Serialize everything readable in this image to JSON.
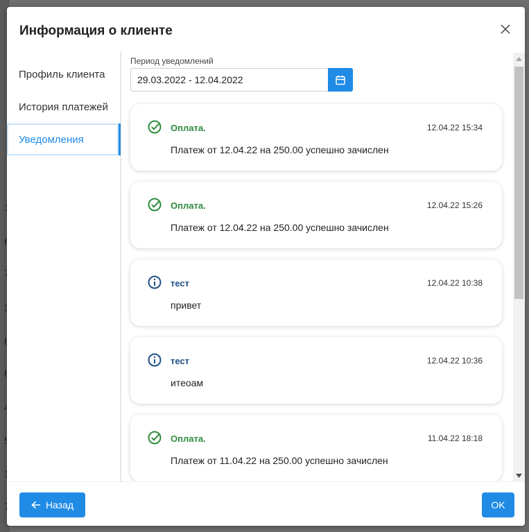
{
  "background": {
    "fragments": [
      "1",
      "6",
      "7",
      "3",
      "6",
      "6",
      "4",
      "5",
      "1",
      "7"
    ]
  },
  "dialog": {
    "title": "Информация о клиенте",
    "close_icon": "close-icon"
  },
  "sidebar": {
    "items": [
      {
        "label": "Профиль клиента",
        "active": false
      },
      {
        "label": "История платежей",
        "active": false
      },
      {
        "label": "Уведомления",
        "active": true
      }
    ]
  },
  "filter": {
    "period_label": "Период уведомлений",
    "date_range": "29.03.2022 - 12.04.2022",
    "calendar_icon": "calendar-icon"
  },
  "notifications": [
    {
      "type": "success",
      "icon": "check-circle-icon",
      "title": "Оплата.",
      "time": "12.04.22 15:34",
      "message": "Платеж от 12.04.22 на 250.00 успешно зачислен"
    },
    {
      "type": "success",
      "icon": "check-circle-icon",
      "title": "Оплата.",
      "time": "12.04.22 15:26",
      "message": "Платеж от 12.04.22 на 250.00 успешно зачислен"
    },
    {
      "type": "info",
      "icon": "info-circle-icon",
      "title": "тест",
      "time": "12.04.22 10:38",
      "message": "привет"
    },
    {
      "type": "info",
      "icon": "info-circle-icon",
      "title": "тест",
      "time": "12.04.22 10:36",
      "message": "итеоам"
    },
    {
      "type": "success",
      "icon": "check-circle-icon",
      "title": "Оплата.",
      "time": "11.04.22 18:18",
      "message": "Платеж от 11.04.22 на 250.00 успешно зачислен"
    }
  ],
  "footer": {
    "back_label": "Назад",
    "ok_label": "OK"
  },
  "colors": {
    "accent": "#1f8be5",
    "success": "#2e8b3d",
    "info": "#1f4f86"
  }
}
